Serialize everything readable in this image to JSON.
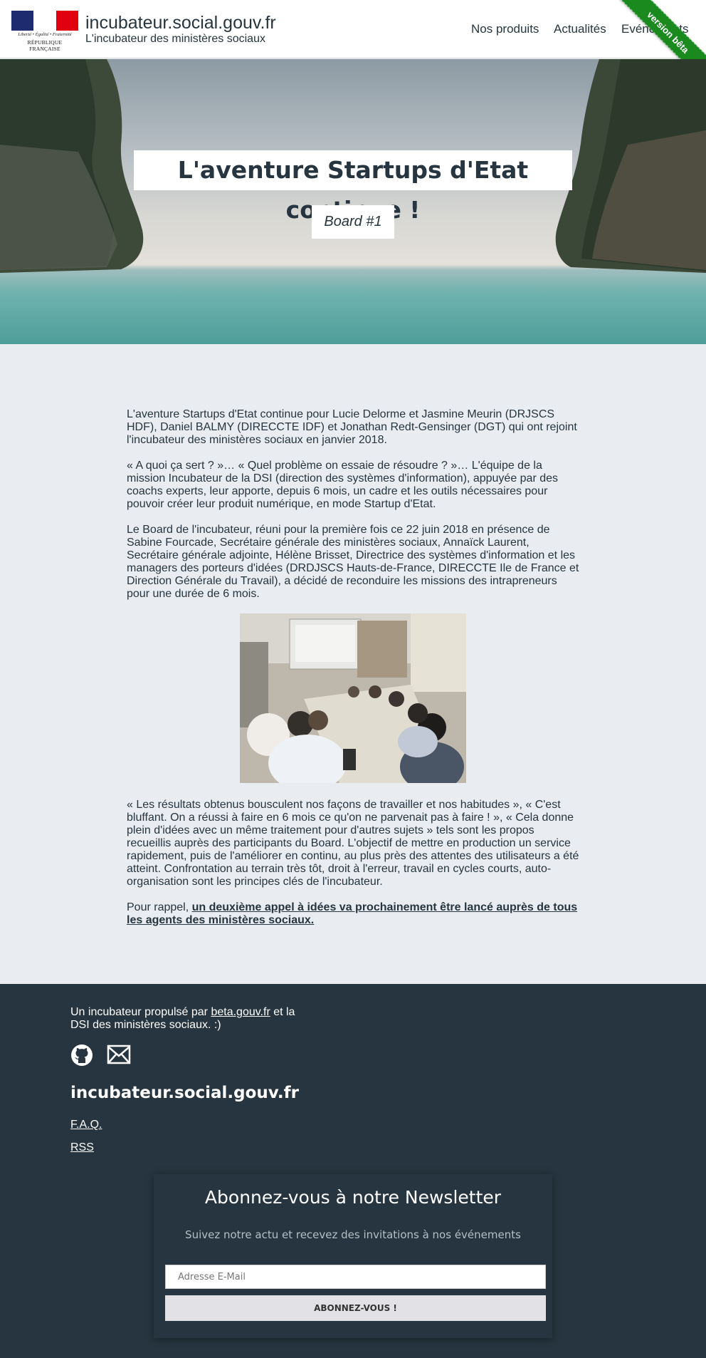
{
  "header": {
    "logo_motto": "Liberté • Égalité • Fraternité",
    "logo_name": "RÉPUBLIQUE FRANÇAISE",
    "site_title": "incubateur.social.gouv.fr",
    "site_subtitle": "L'incubateur des ministères sociaux",
    "nav": [
      "Nos produits",
      "Actualités",
      "Evénements"
    ],
    "ribbon": "version bêta",
    "ribbon_color": "#1a8a1f"
  },
  "hero": {
    "title": "L'aventure Startups d'Etat continue !",
    "subtitle": "Board #1"
  },
  "article": {
    "paragraphs": [
      "L'aventure Startups d'Etat continue pour Lucie Delorme et Jasmine Meurin (DRJSCS HDF), Daniel BALMY (DIRECCTE IDF) et Jonathan Redt-Gensinger (DGT) qui ont rejoint l'incubateur des ministères sociaux en janvier 2018.",
      "« A quoi ça sert ? »… « Quel problème on essaie de résoudre ? »… L'équipe de la mission Incubateur de la DSI (direction des systèmes d'information), appuyée par des coachs experts, leur apporte, depuis 6 mois, un cadre et les outils nécessaires pour pouvoir créer leur produit numérique, en mode Startup d'Etat.",
      "Le Board de l'incubateur, réuni pour la première fois ce 22 juin 2018 en présence de Sabine Fourcade, Secrétaire générale des ministères sociaux, Annaïck Laurent, Secrétaire générale adjointe, Hélène Brisset, Directrice des systèmes d'information et les managers des porteurs d'idées (DRDJSCS Hauts-de-France, DIRECCTE Ile de France et Direction Générale du Travail), a décidé de reconduire les missions des intrapreneurs pour une durée de 6 mois.",
      "« Les résultats obtenus bousculent nos façons de travailler et nos habitudes », « C'est bluffant. On a réussi à faire en 6 mois ce qu'on ne parvenait pas à faire ! », « Cela donne plein d'idées avec un même traitement pour d'autres sujets » tels sont les propos recueillis auprès des participants du Board. L'objectif de mettre en production un service rapidement, puis de l'améliorer en continu, au plus près des attentes des utilisateurs a été atteint. Confrontation au terrain très tôt, droit à l'erreur, travail en cycles courts, auto-organisation sont les principes clés de l'incubateur."
    ],
    "reminder_prefix": "Pour rappel, ",
    "reminder_link": "un deuxième appel à idées va prochainement être lancé auprès de tous les agents des ministères sociaux."
  },
  "footer": {
    "intro_prefix": "Un incubateur propulsé par ",
    "intro_link": "beta.gouv.fr",
    "intro_suffix": " et la DSI des ministères sociaux. :)",
    "site_name": "incubateur.social.gouv.fr",
    "links": [
      "F.A.Q.",
      "RSS"
    ]
  },
  "newsletter": {
    "title": "Abonnez-vous à notre Newsletter",
    "subtitle": "Suivez notre actu et recevez des invitations à nos événements",
    "email_placeholder": "Adresse E-Mail",
    "email_value": "",
    "button_label": "ABONNEZ-VOUS !"
  },
  "colors": {
    "primary": "#26353f",
    "background": "#e9ecf1",
    "footer": "#26353f",
    "flag_blue": "#1e2b6e",
    "flag_red": "#e1000f"
  }
}
